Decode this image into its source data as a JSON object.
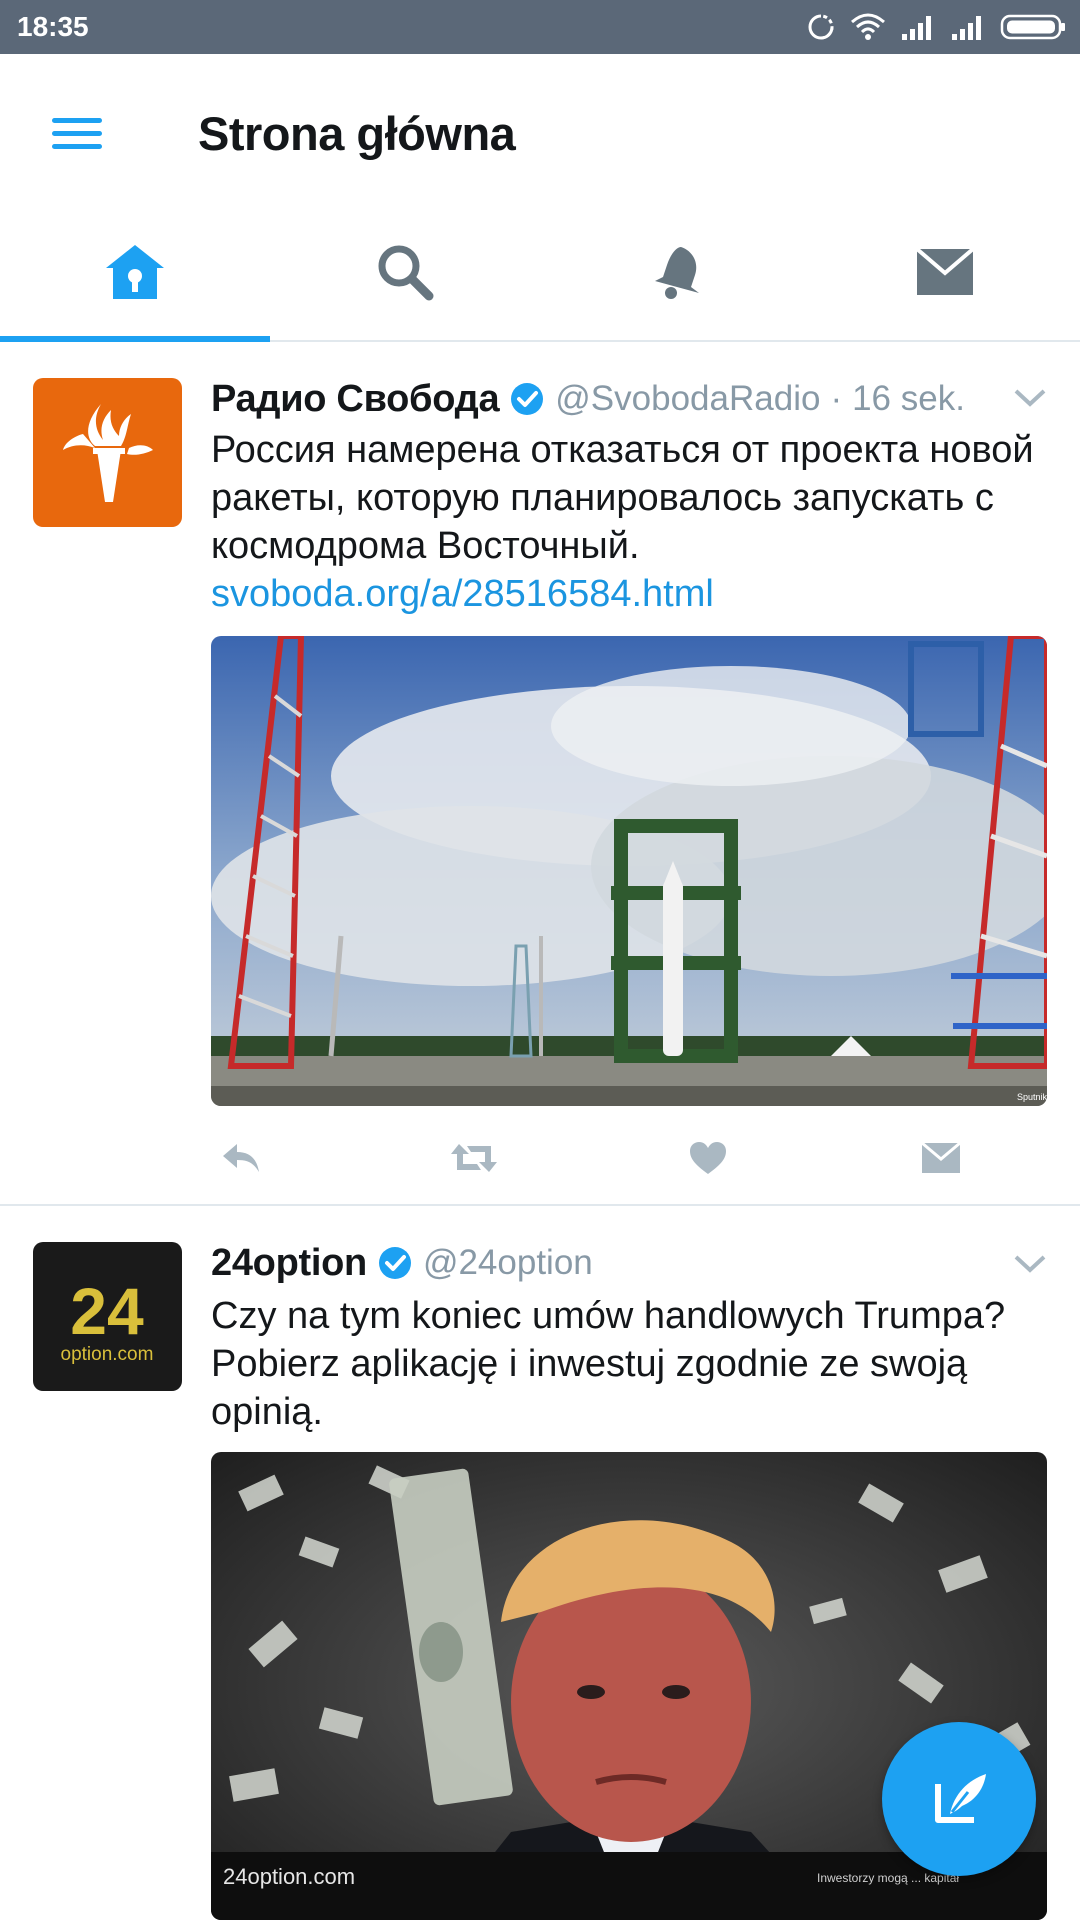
{
  "status_bar": {
    "time": "18:35"
  },
  "app_bar": {
    "title": "Strona główna"
  },
  "tabs": [
    {
      "name": "home",
      "icon": "home-icon",
      "active": true
    },
    {
      "name": "search",
      "icon": "search-icon",
      "active": false
    },
    {
      "name": "notifications",
      "icon": "bell-icon",
      "active": false
    },
    {
      "name": "messages",
      "icon": "envelope-icon",
      "active": false
    }
  ],
  "tweets": [
    {
      "name": "Радио Свобода",
      "verified": true,
      "handle": "@SvobodaRadio",
      "separator": "·",
      "time": "16 sek.",
      "text": "Россия намерена отказаться от проекта новой ракеты, которую планировалось запускать с космодрома Восточный.",
      "link": "svoboda.org/a/28516584.html",
      "media_credit": "Sputnik",
      "avatar_color": "#e8680d"
    },
    {
      "name": "24option",
      "verified": true,
      "handle": "@24option",
      "text": "Czy na tym koniec umów handlowych Trumpa? Pobierz aplikację i inwestuj zgodnie ze swoją opinią.",
      "avatar_text_big": "24",
      "avatar_text_small": "option.com",
      "media_brand": "24option.com",
      "media_disclaimer": "Inwestorzy mogą ... kapitał"
    }
  ],
  "colors": {
    "accent": "#1da1f2",
    "status_bar": "#5b6878",
    "muted": "#8899a6",
    "link": "#1b95e0"
  }
}
